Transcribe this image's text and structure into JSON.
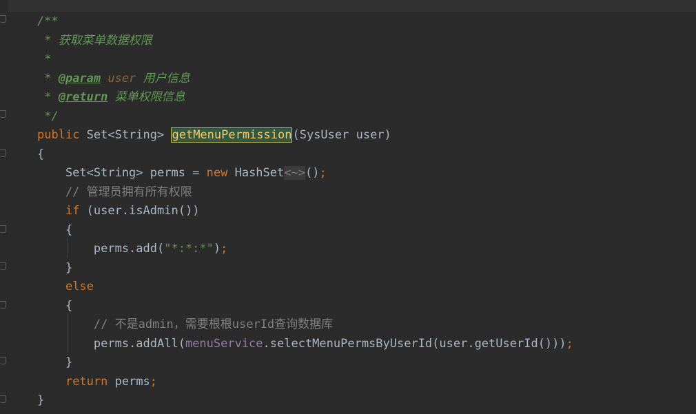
{
  "editor": {
    "lines": [
      {
        "id": "l1",
        "tokens": [
          {
            "t": "/**",
            "c": "doc"
          }
        ]
      },
      {
        "id": "l2",
        "tokens": [
          {
            "t": " * 获取菜单数据权限",
            "c": "doc"
          }
        ]
      },
      {
        "id": "l3",
        "tokens": [
          {
            "t": " *",
            "c": "doc"
          }
        ]
      },
      {
        "id": "l4",
        "tokens": [
          {
            "t": " * ",
            "c": "doc"
          },
          {
            "t": "@param",
            "c": "doctag"
          },
          {
            "t": " ",
            "c": "doc"
          },
          {
            "t": "user",
            "c": "docparam"
          },
          {
            "t": " 用户信息",
            "c": "doc"
          }
        ]
      },
      {
        "id": "l5",
        "tokens": [
          {
            "t": " * ",
            "c": "doc"
          },
          {
            "t": "@return",
            "c": "doctag"
          },
          {
            "t": " 菜单权限信息",
            "c": "doc"
          }
        ]
      },
      {
        "id": "l6",
        "tokens": [
          {
            "t": " */",
            "c": "doc"
          }
        ]
      },
      {
        "id": "l7",
        "tokens": [
          {
            "t": "public",
            "c": "kw"
          },
          {
            "t": " Set<String> ",
            "c": ""
          },
          {
            "t": "getMenuPermission",
            "c": "hl"
          },
          {
            "t": "(SysUser user)",
            "c": ""
          }
        ]
      },
      {
        "id": "l8",
        "tokens": [
          {
            "t": "{",
            "c": ""
          }
        ]
      },
      {
        "id": "l9",
        "tokens": [
          {
            "t": "    Set<String> perms = ",
            "c": ""
          },
          {
            "t": "new",
            "c": "kw"
          },
          {
            "t": " HashSet",
            "c": ""
          },
          {
            "t": "<~>",
            "c": "diamond"
          },
          {
            "t": "()",
            "c": ""
          },
          {
            "t": ";",
            "c": "punct"
          }
        ]
      },
      {
        "id": "l10",
        "tokens": [
          {
            "t": "    // 管理员拥有所有权限",
            "c": "cm"
          }
        ]
      },
      {
        "id": "l11",
        "tokens": [
          {
            "t": "    ",
            "c": ""
          },
          {
            "t": "if",
            "c": "kw"
          },
          {
            "t": " (user.isAdmin())",
            "c": ""
          }
        ]
      },
      {
        "id": "l12",
        "tokens": [
          {
            "t": "    {",
            "c": ""
          }
        ]
      },
      {
        "id": "l13",
        "tokens": [
          {
            "t": "        perms.add(",
            "c": ""
          },
          {
            "t": "\"*:*:*\"",
            "c": "str"
          },
          {
            "t": ")",
            "c": ""
          },
          {
            "t": ";",
            "c": "punct"
          }
        ]
      },
      {
        "id": "l14",
        "tokens": [
          {
            "t": "    }",
            "c": ""
          }
        ]
      },
      {
        "id": "l15",
        "tokens": [
          {
            "t": "    ",
            "c": ""
          },
          {
            "t": "else",
            "c": "kw"
          }
        ]
      },
      {
        "id": "l16",
        "tokens": [
          {
            "t": "    {",
            "c": ""
          }
        ]
      },
      {
        "id": "l17",
        "tokens": [
          {
            "t": "        // 不是admin，需要根根userId查询数据库",
            "c": "cm"
          }
        ]
      },
      {
        "id": "l18",
        "tokens": [
          {
            "t": "        perms.addAll(",
            "c": ""
          },
          {
            "t": "menuService",
            "c": "fld"
          },
          {
            "t": ".selectMenuPermsByUserId(user.getUserId()))",
            "c": ""
          },
          {
            "t": ";",
            "c": "punct"
          }
        ]
      },
      {
        "id": "l19",
        "tokens": [
          {
            "t": "    }",
            "c": ""
          }
        ]
      },
      {
        "id": "l20",
        "tokens": [
          {
            "t": "    ",
            "c": ""
          },
          {
            "t": "return",
            "c": "kw"
          },
          {
            "t": " perms",
            "c": ""
          },
          {
            "t": ";",
            "c": "punct"
          }
        ]
      },
      {
        "id": "l21",
        "tokens": [
          {
            "t": "}",
            "c": ""
          }
        ]
      }
    ]
  }
}
